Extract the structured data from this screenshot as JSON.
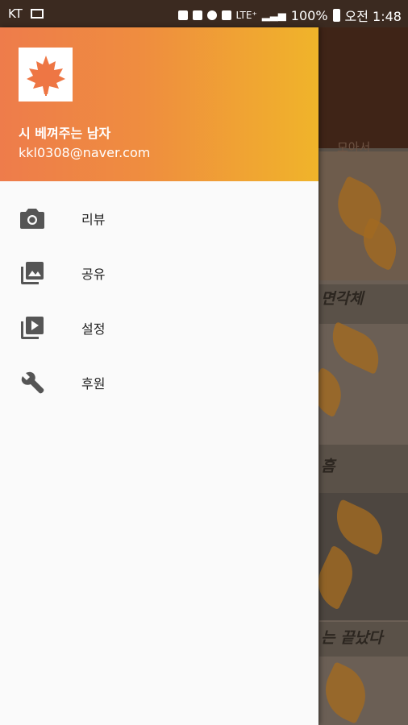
{
  "status_bar": {
    "carrier": "KT",
    "network": "LTE⁺",
    "battery": "100%",
    "time": "오전 1:48"
  },
  "drawer": {
    "header": {
      "user_name": "시 베껴주는 남자",
      "user_email": "kkl0308@naver.com",
      "gradient": [
        "#ee7c4b",
        "#f0b42a"
      ]
    },
    "menu": [
      {
        "label": "리뷰",
        "icon": "camera-icon"
      },
      {
        "label": "공유",
        "icon": "photo-library-icon"
      },
      {
        "label": "설정",
        "icon": "video-library-icon"
      },
      {
        "label": "후원",
        "icon": "wrench-icon"
      }
    ]
  },
  "background": {
    "tab_label": "모아서",
    "captions": [
      "면각체",
      "흠",
      "는 끝났다"
    ]
  },
  "colors": {
    "drawer_bg": "#fafafa",
    "icon": "#555555",
    "text": "#222222"
  }
}
